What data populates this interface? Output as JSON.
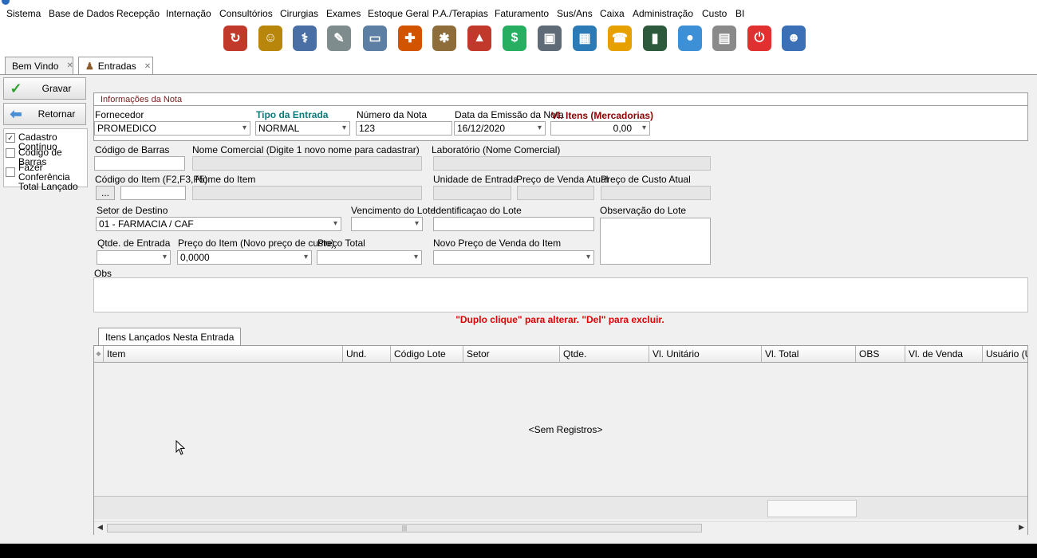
{
  "menu": [
    "Sistema",
    "Base de Dados",
    "Recepção",
    "Internação",
    "Consultórios",
    "Cirurgias",
    "Exames",
    "Estoque Geral",
    "P.A./Terapias",
    "Faturamento",
    "Sus/Ans",
    "Caixa",
    "Administração",
    "Custo",
    "BI"
  ],
  "toolbar": [
    {
      "name": "users-refresh-icon",
      "glyph": "↻",
      "color": "#c0392b"
    },
    {
      "name": "patient-icon",
      "glyph": "☺",
      "color": "#b8860b"
    },
    {
      "name": "doctor-icon",
      "glyph": "⚕",
      "color": "#4a6fa5"
    },
    {
      "name": "notes-icon",
      "glyph": "✎",
      "color": "#7f8c8d"
    },
    {
      "name": "bed-icon",
      "glyph": "▭",
      "color": "#5d7fa3"
    },
    {
      "name": "ambulance-icon",
      "glyph": "✚",
      "color": "#d35400"
    },
    {
      "name": "medicine-icon",
      "glyph": "✱",
      "color": "#8e6d3a"
    },
    {
      "name": "stock-icon",
      "glyph": "▲",
      "color": "#c0392b"
    },
    {
      "name": "money-icon",
      "glyph": "$",
      "color": "#27ae60"
    },
    {
      "name": "safe-icon",
      "glyph": "▣",
      "color": "#5f6b77"
    },
    {
      "name": "finance-icon",
      "glyph": "▦",
      "color": "#2c7bb6"
    },
    {
      "name": "phone-icon",
      "glyph": "☎",
      "color": "#e6a100"
    },
    {
      "name": "book-icon",
      "glyph": "▮",
      "color": "#2d5a3d"
    },
    {
      "name": "chat-icon",
      "glyph": "●",
      "color": "#3d8fd6"
    },
    {
      "name": "report-icon",
      "glyph": "▤",
      "color": "#8a8a8a"
    },
    {
      "name": "power-icon",
      "glyph": "⏻",
      "color": "#e03030"
    },
    {
      "name": "user-icon",
      "glyph": "☻",
      "color": "#3b6fb6"
    }
  ],
  "tabs": {
    "welcome": "Bem Vindo",
    "entries": "Entradas",
    "close": "✕"
  },
  "left": {
    "save": "Gravar",
    "back": "Retornar",
    "chk_continuous": "Cadastro Contínuo",
    "chk_barcode": "Código de Barras",
    "chk_conf1": "Fazer Conferência",
    "chk_conf2": "Total Lançado",
    "checkmark": "✓"
  },
  "nota": {
    "header": "Informações da Nota",
    "fornecedor_label": "Fornecedor",
    "fornecedor": "PROMEDICO",
    "tipo_label": "Tipo da Entrada",
    "tipo": "NORMAL",
    "numero_label": "Número da Nota",
    "numero": "123",
    "data_label": "Data da Emissão da Nota",
    "data": "16/12/2020",
    "vl_label": "Vl. Itens (Mercadorias)",
    "vl": "0,00"
  },
  "item": {
    "barcode_label": "Código de Barras",
    "nome_comercial_label": "Nome Comercial (Digite 1 novo nome para cadastrar)",
    "lab_label": "Laboratório (Nome Comercial)",
    "cod_item_label": "Código do Item (F2,F3,F5)",
    "browse": "...",
    "nome_item_label": "Nome do Item",
    "unidade_label": "Unidade de Entrada",
    "preco_venda_label": "Preço de Venda Atual",
    "preco_custo_label": "Preço de Custo Atual",
    "setor_label": "Setor de Destino",
    "setor": "01 - FARMACIA / CAF",
    "venc_label": "Vencimento do Lote",
    "ident_label": "Identificaçao do Lote",
    "obs_lote_label": "Observação do Lote",
    "qtde_label": "Qtde. de Entrada",
    "preco_item_label": "Preço do Item (Novo preço de custo)",
    "preco_item": "0,0000",
    "preco_total_label": "Preço Total",
    "novo_preco_label": "Novo Preço de Venda do Item",
    "obs_label": "Obs"
  },
  "hint": "\"Duplo clique\" para alterar. \"Del\" para excluir.",
  "grid": {
    "tab": "Itens Lançados Nesta Entrada",
    "columns": [
      "Item",
      "Und.",
      "Código Lote",
      "Setor",
      "Qtde.",
      "Vl. Unitário",
      "Vl. Total",
      "OBS",
      "Vl. de Venda",
      "Usuário (Últ"
    ],
    "empty": "<Sem Registros>",
    "thumb": "|||"
  }
}
